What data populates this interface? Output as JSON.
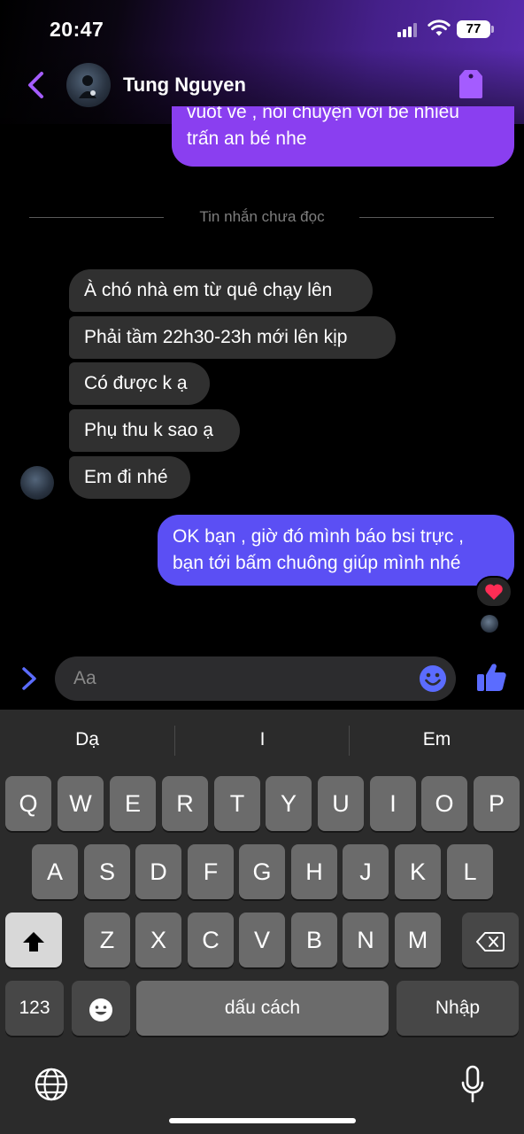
{
  "status_bar": {
    "time": "20:47",
    "battery": "77"
  },
  "header": {
    "contact_name": "Tung Nguyen"
  },
  "messages": {
    "outgoing_top": {
      "line1": "vuốt ve , nói chuyện với bé nhiều",
      "line2": "trấn an bé nhe"
    },
    "unread_divider": "Tin nhắn chưa đọc",
    "incoming": [
      "À chó nhà em từ quê chạy lên",
      "Phải tầm 22h30-23h mới lên kịp",
      "Có được k ạ",
      "Phụ thu k sao ạ",
      "Em đi nhé"
    ],
    "outgoing_bottom": {
      "line1": "OK bạn , giờ đó mình báo bsi trực ,",
      "line2": "bạn tới bấm chuông giúp mình nhé"
    },
    "reaction": "❤️"
  },
  "composer": {
    "placeholder": "Aa"
  },
  "keyboard": {
    "suggestions": [
      "Dạ",
      "I",
      "Em"
    ],
    "row1": [
      "Q",
      "W",
      "E",
      "R",
      "T",
      "Y",
      "U",
      "I",
      "O",
      "P"
    ],
    "row2": [
      "A",
      "S",
      "D",
      "F",
      "G",
      "H",
      "J",
      "K",
      "L"
    ],
    "row3": [
      "Z",
      "X",
      "C",
      "V",
      "B",
      "N",
      "M"
    ],
    "numbers_key": "123",
    "space_key": "dấu cách",
    "return_key": "Nhập"
  },
  "colors": {
    "accent": "#8a3ff0",
    "outgoing_bubble": "#5b4ff4",
    "incoming_bubble": "#303030",
    "keyboard_bg": "#2b2b2b"
  },
  "icons": [
    "back-chevron-icon",
    "tag-icon",
    "expand-chevron-icon",
    "emoji-icon",
    "thumbs-up-icon",
    "shift-icon",
    "backspace-icon",
    "emoji-keyboard-icon",
    "globe-icon",
    "microphone-icon"
  ]
}
